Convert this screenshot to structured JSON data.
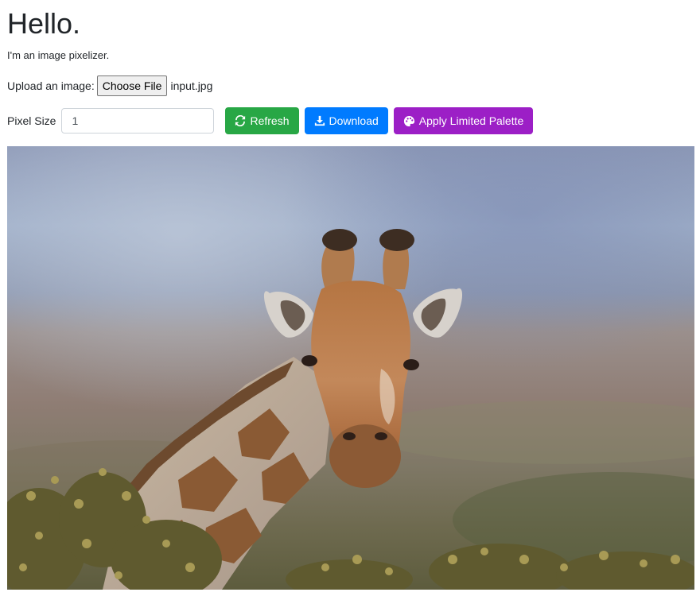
{
  "header": {
    "title": "Hello.",
    "subtitle": "I'm an image pixelizer."
  },
  "upload": {
    "label": "Upload an image:",
    "button_label": "Choose File",
    "file_name": "input.jpg"
  },
  "controls": {
    "pixel_size_label": "Pixel Size",
    "pixel_size_value": "1",
    "refresh_label": "Refresh",
    "download_label": "Download",
    "palette_label": "Apply Limited Palette"
  },
  "colors": {
    "refresh": "#28a745",
    "download": "#007bff",
    "palette": "#9c1fc6"
  },
  "icons": {
    "refresh": "sync-icon",
    "download": "download-icon",
    "palette": "palette-icon"
  }
}
